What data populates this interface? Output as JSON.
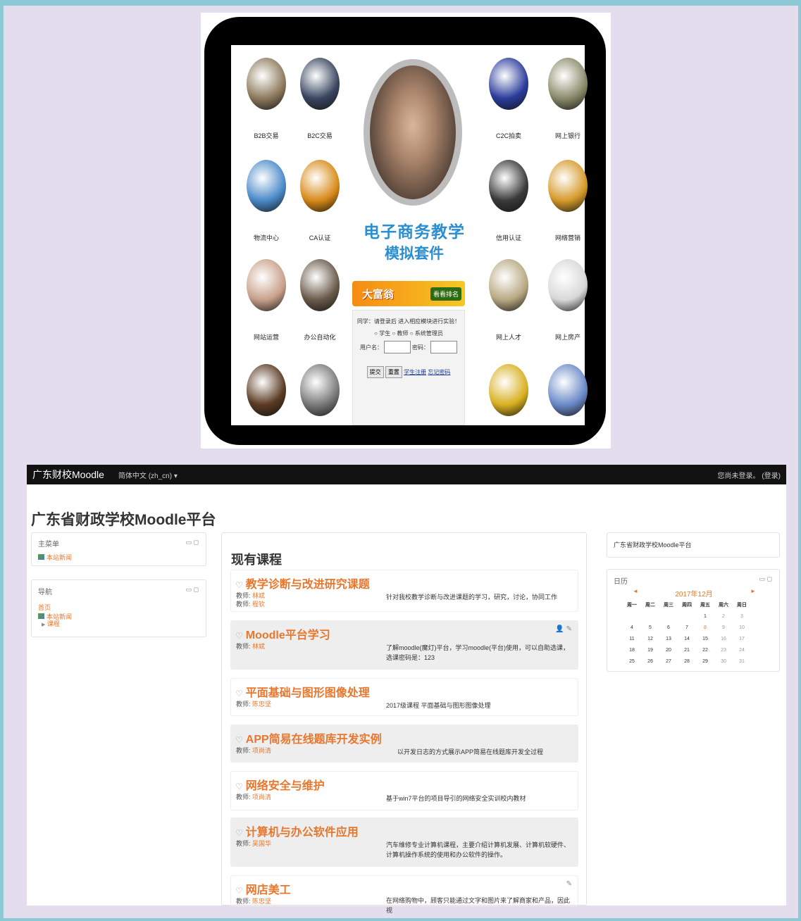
{
  "portal": {
    "tiles": [
      {
        "label": "B2B交易",
        "color": "#8c7a5c"
      },
      {
        "label": "B2C交易",
        "color": "#3a4660"
      },
      {
        "label": "C2C拍卖",
        "color": "#2a3c9a"
      },
      {
        "label": "网上银行",
        "color": "#8a8a6a"
      },
      {
        "label": "物流中心",
        "color": "#4a8ac8"
      },
      {
        "label": "CA认证",
        "color": "#d88a18"
      },
      {
        "label": "信用认证",
        "color": "#3a3a3a"
      },
      {
        "label": "网络营销",
        "color": "#d69a2a"
      },
      {
        "label": "网站运营",
        "color": "#c8a08a"
      },
      {
        "label": "办公自动化",
        "color": "#6a5a4a"
      },
      {
        "label": "网上人才",
        "color": "#b8a882"
      },
      {
        "label": "网上房产",
        "color": "#d8d8d8"
      },
      {
        "label": "",
        "color": "#5a3a22"
      },
      {
        "label": "",
        "color": "#7a7a7a"
      },
      {
        "label": "",
        "color": "#d8b020"
      },
      {
        "label": "",
        "color": "#6a8ac8"
      }
    ],
    "title_line1": "电子商务教学",
    "title_line2": "模拟套件",
    "banner_text": "大富翁",
    "banner_button": "看看排名",
    "login_hint": "同学：请登录后 进入相应模块进行实验！",
    "roles": [
      "学生",
      "教师",
      "系统管理员"
    ],
    "username_label": "用户名：",
    "password_label": "密码：",
    "submit_label": "提交",
    "reset_label": "重置",
    "register_link": "学生注册",
    "forgot_link": "忘记密码"
  },
  "navbar": {
    "brand": "广东财校Moodle",
    "language": "简体中文 (zh_cn) ▾",
    "login_status": "您尚未登录。 (登录)"
  },
  "page_title": "广东省财政学校Moodle平台",
  "main_menu": {
    "title": "主菜单",
    "controls": "▭ ◻",
    "item": "本站新闻"
  },
  "navigation": {
    "title": "导航",
    "controls": "▭ ◻",
    "home": "首页",
    "news": "本站新闻",
    "courses": "课程"
  },
  "courses_heading": "现有课程",
  "courses": [
    {
      "name": "教学诊断与改进研究课题",
      "teachers": [
        "林斌",
        "程钦"
      ],
      "summary": "针对我校教学诊断与改进课题的学习，研究，讨论，协同工作",
      "tools": ""
    },
    {
      "name": "Moodle平台学习",
      "teachers": [
        "林斌"
      ],
      "summary": "了解moodle(魔灯)平台，学习moodle(平台)使用，可以自助选课，选课密码是：123",
      "tools": "👤 ✎"
    },
    {
      "name": "平面基础与图形图像处理",
      "teachers": [
        "陈忠坚"
      ],
      "summary": "2017级课程 平面基础与图形图像处理",
      "tools": ""
    },
    {
      "name": "APP简易在线题库开发实例",
      "teachers": [
        "项尚清"
      ],
      "summary": "以开发日志的方式展示APP简易在线题库开发全过程",
      "tools": ""
    },
    {
      "name": "网络安全与维护",
      "teachers": [
        "项尚清"
      ],
      "summary": "基于win7平台的项目导引的网络安全实训校内教材",
      "tools": ""
    },
    {
      "name": "计算机与办公软件应用",
      "teachers": [
        "吴国华"
      ],
      "summary": "汽车维修专业计算机课程，主要介绍计算机发展、计算机软硬件、计算机操作系统的使用和办公软件的操作。",
      "tools": ""
    },
    {
      "name": "网店美工",
      "teachers": [
        "陈忠坚"
      ],
      "summary": "在网络购物中，顾客只能通过文字和图片来了解商家和产品，因此视",
      "tools": "✎"
    }
  ],
  "teacher_label": "教师: ",
  "right_block": {
    "title": "广东省财政学校Moodle平台"
  },
  "calendar": {
    "title": "日历",
    "controls": "▭ ◻",
    "prev": "◄",
    "next": "►",
    "month": "2017年12月",
    "weekdays": [
      "周一",
      "周二",
      "周三",
      "周四",
      "周五",
      "周六",
      "周日"
    ],
    "weeks": [
      [
        "",
        "",
        "",
        "",
        "1",
        "2",
        "3"
      ],
      [
        "4",
        "5",
        "6",
        "7",
        "8",
        "9",
        "10"
      ],
      [
        "11",
        "12",
        "13",
        "14",
        "15",
        "16",
        "17"
      ],
      [
        "18",
        "19",
        "20",
        "21",
        "22",
        "23",
        "24"
      ],
      [
        "25",
        "26",
        "27",
        "28",
        "29",
        "30",
        "31"
      ]
    ],
    "today": "8"
  }
}
